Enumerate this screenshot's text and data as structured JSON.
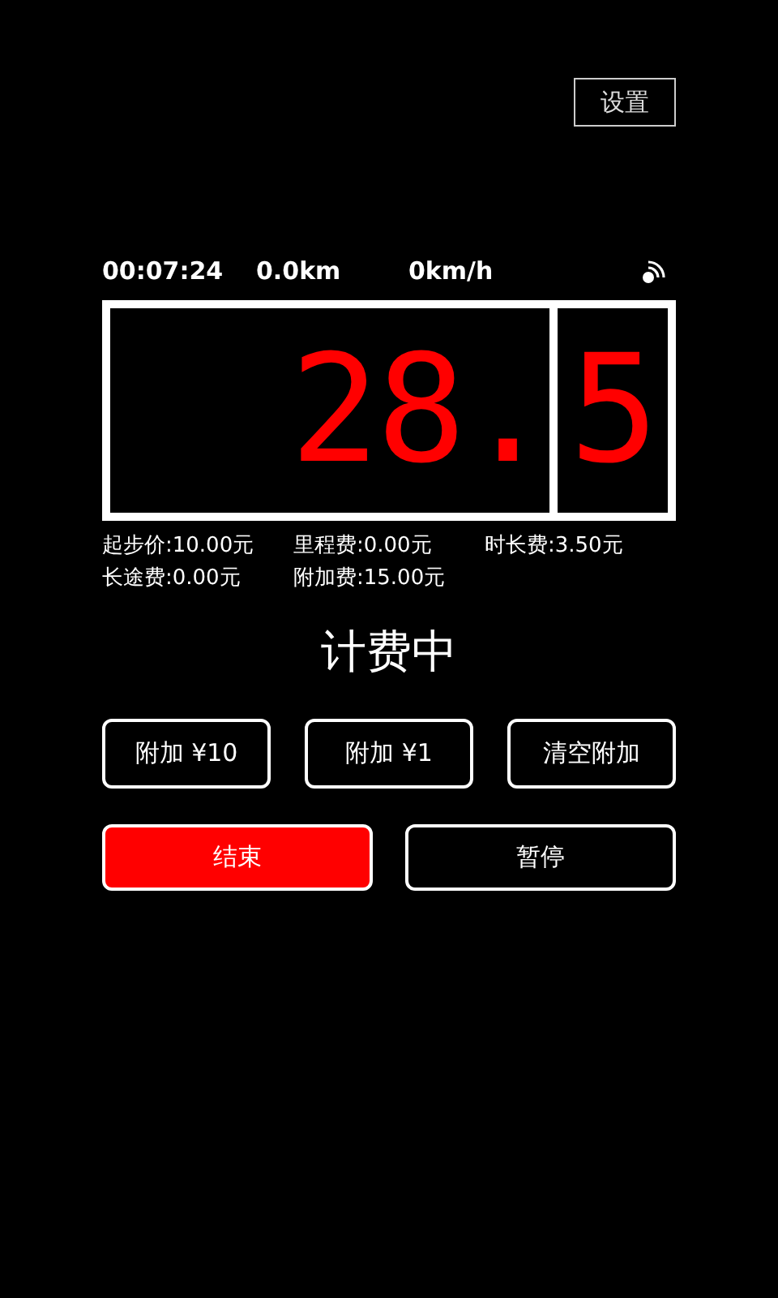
{
  "settings_button": "设置",
  "stats": {
    "elapsed": "00:07:24",
    "distance": "0.0km",
    "speed": "0km/h"
  },
  "meter": {
    "main": "28.",
    "fraction": "5"
  },
  "fees": [
    "起步价:10.00元",
    "里程费:0.00元",
    "时长费:3.50元",
    "长途费:0.00元",
    "附加费:15.00元"
  ],
  "status": "计费中",
  "surcharge_buttons": [
    "附加 ¥10",
    "附加 ¥1",
    "清空附加"
  ],
  "actions": [
    {
      "label": "结束",
      "kind": "primary"
    },
    {
      "label": "暂停",
      "kind": "outline"
    }
  ]
}
